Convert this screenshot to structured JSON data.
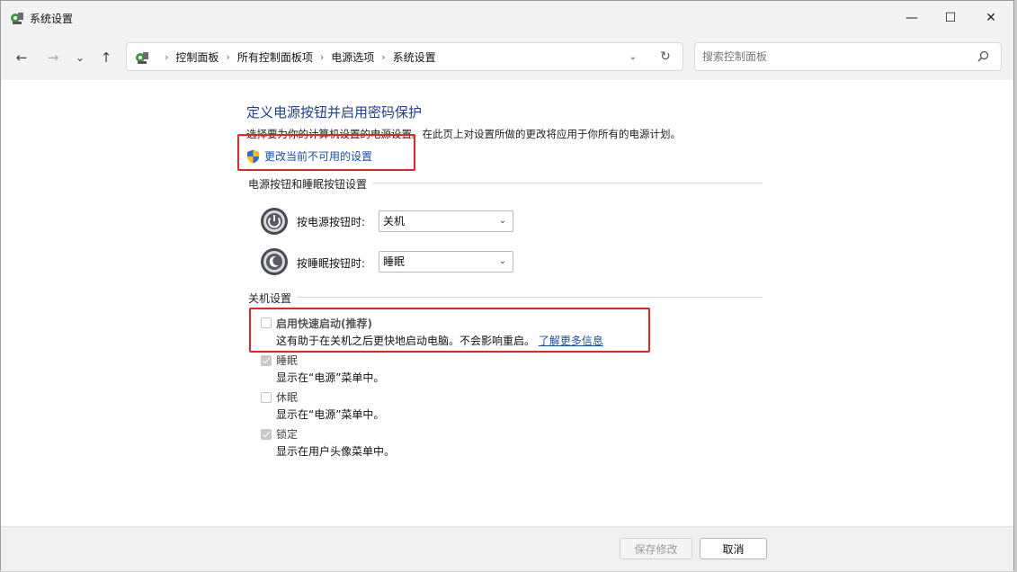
{
  "window": {
    "title": "系统设置",
    "controls": {
      "minimize": "—",
      "maximize": "☐",
      "close": "✕"
    }
  },
  "nav": {
    "back": "←",
    "forward": "→",
    "recent": "⌄",
    "up": "↑"
  },
  "address": {
    "crumbs": [
      "控制面板",
      "所有控制面板项",
      "电源选项",
      "系统设置"
    ],
    "separator": "›",
    "dropdown": "⌄",
    "refresh": "↻"
  },
  "search": {
    "placeholder": "搜索控制面板",
    "value": ""
  },
  "page": {
    "heading": "定义电源按钮并启用密码保护",
    "description": "选择要为你的计算机设置的电源设置。在此页上对设置所做的更改将应用于你所有的电源计划。",
    "change_link": "更改当前不可用的设置"
  },
  "buttons_group": {
    "title": "电源按钮和睡眠按钮设置",
    "power_label": "按电源按钮时:",
    "power_value": "关机",
    "sleep_label": "按睡眠按钮时:",
    "sleep_value": "睡眠"
  },
  "shutdown_group": {
    "title": "关机设置",
    "fast_startup": {
      "label": "启用快速启动(推荐)",
      "desc": "这有助于在关机之后更快地启动电脑。不会影响重启。",
      "link": "了解更多信息",
      "checked": false
    },
    "sleep": {
      "label": "睡眠",
      "desc": "显示在“电源”菜单中。",
      "checked": true
    },
    "hibernate": {
      "label": "休眠",
      "desc": "显示在“电源”菜单中。",
      "checked": false
    },
    "lock": {
      "label": "锁定",
      "desc": "显示在用户头像菜单中。",
      "checked": true
    }
  },
  "footer": {
    "save": "保存修改",
    "cancel": "取消"
  },
  "colors": {
    "heading": "#1e3f8f",
    "link": "#1d4fa3",
    "highlight": "#e5261e"
  }
}
